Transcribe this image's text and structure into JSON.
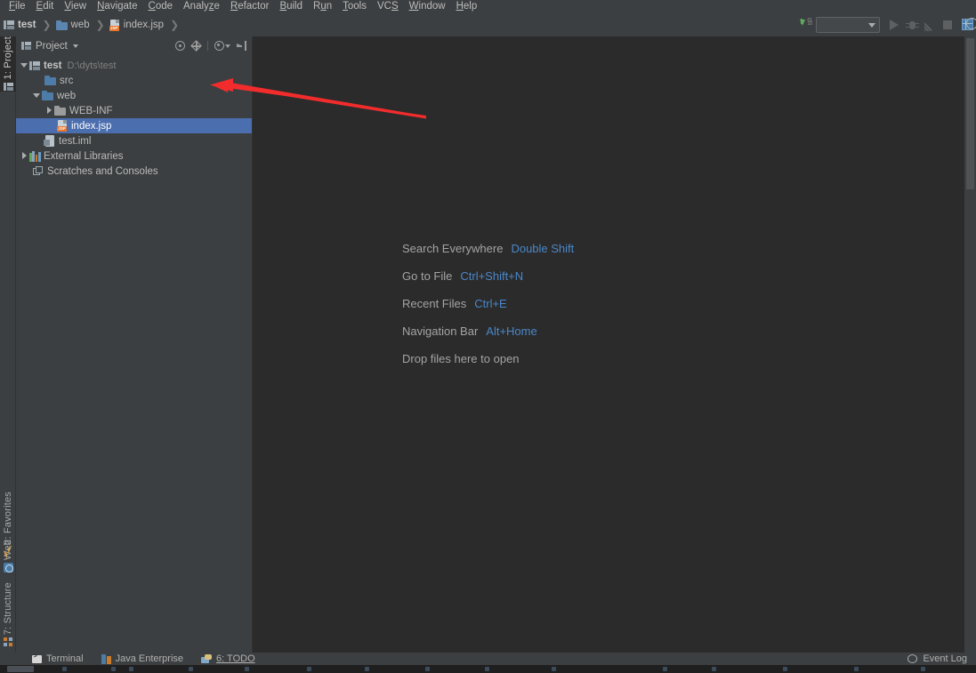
{
  "menubar": {
    "items": [
      {
        "label": "File",
        "mnemonic": "F"
      },
      {
        "label": "Edit",
        "mnemonic": "E"
      },
      {
        "label": "View",
        "mnemonic": "V"
      },
      {
        "label": "Navigate",
        "mnemonic": "N"
      },
      {
        "label": "Code",
        "mnemonic": "C"
      },
      {
        "label": "Analyze",
        "mnemonic": "z"
      },
      {
        "label": "Refactor",
        "mnemonic": "R"
      },
      {
        "label": "Build",
        "mnemonic": "B"
      },
      {
        "label": "Run",
        "mnemonic": "u"
      },
      {
        "label": "Tools",
        "mnemonic": "T"
      },
      {
        "label": "VCS",
        "mnemonic": "S"
      },
      {
        "label": "Window",
        "mnemonic": "W"
      },
      {
        "label": "Help",
        "mnemonic": "H"
      }
    ]
  },
  "breadcrumb": {
    "items": [
      {
        "label": "test",
        "icon": "project-module-icon"
      },
      {
        "label": "web",
        "icon": "folder-icon"
      },
      {
        "label": "index.jsp",
        "icon": "jsp-file-icon"
      }
    ],
    "separator": "❯",
    "jsp_badge": "JSP"
  },
  "toolbar": {
    "run_config_value": "",
    "run_config_placeholder": "",
    "buttons": [
      {
        "name": "run-button",
        "label": "Run",
        "enabled": false
      },
      {
        "name": "debug-button",
        "label": "Debug",
        "enabled": false
      },
      {
        "name": "coverage-button",
        "label": "Run with Coverage",
        "enabled": false
      },
      {
        "name": "stop-button",
        "label": "Stop",
        "enabled": false
      }
    ],
    "updown_label": "01\n10",
    "search_label": "Search"
  },
  "tool_stripe": {
    "left": [
      {
        "label": "1: Project",
        "icon": "project-icon",
        "active": true
      },
      {
        "label": "2: Favorites",
        "icon": "star-icon",
        "active": false
      },
      {
        "label": "Web",
        "icon": "web-icon",
        "active": false
      },
      {
        "label": "7: Structure",
        "icon": "structure-icon",
        "active": false
      }
    ]
  },
  "project_panel": {
    "title": "Project",
    "tools": [
      {
        "name": "scroll-from-source-icon",
        "label": "Select Opened File"
      },
      {
        "name": "collapse-all-icon",
        "label": "Collapse All"
      },
      {
        "name": "gear-icon",
        "label": "Settings"
      },
      {
        "name": "hide-panel-icon",
        "label": "Hide"
      }
    ],
    "tree": [
      {
        "label": "test",
        "path": "D:\\dyts\\test",
        "icon": "project-module-icon",
        "twisty": "open",
        "indent": 0,
        "bold": true,
        "selected": false
      },
      {
        "label": "src",
        "path": "",
        "icon": "source-folder-icon",
        "twisty": "none",
        "indent": 1,
        "bold": false,
        "selected": false
      },
      {
        "label": "web",
        "path": "",
        "icon": "source-folder-icon",
        "twisty": "open",
        "indent": 1,
        "bold": false,
        "selected": false
      },
      {
        "label": "WEB-INF",
        "path": "",
        "icon": "folder-gray-icon",
        "twisty": "closed",
        "indent": 2,
        "bold": false,
        "selected": false
      },
      {
        "label": "index.jsp",
        "path": "",
        "icon": "jsp-file-icon",
        "twisty": "none",
        "indent": 2,
        "bold": false,
        "selected": true
      },
      {
        "label": "test.iml",
        "path": "",
        "icon": "iml-file-icon",
        "twisty": "none",
        "indent": 1,
        "bold": false,
        "selected": false
      },
      {
        "label": "External Libraries",
        "path": "",
        "icon": "library-icon",
        "twisty": "closed",
        "indent": 0,
        "bold": false,
        "selected": false
      },
      {
        "label": "Scratches and Consoles",
        "path": "",
        "icon": "scratches-icon",
        "twisty": "none",
        "indent": 0,
        "bold": false,
        "selected": false
      }
    ]
  },
  "editor": {
    "hints": [
      {
        "name": "Search Everywhere",
        "key": "Double Shift"
      },
      {
        "name": "Go to File",
        "key": "Ctrl+Shift+N"
      },
      {
        "name": "Recent Files",
        "key": "Ctrl+E"
      },
      {
        "name": "Navigation Bar",
        "key": "Alt+Home"
      },
      {
        "name": "Drop files here to open",
        "key": ""
      }
    ]
  },
  "statusbar": {
    "tabs": [
      {
        "label": "Terminal",
        "icon": "terminal-icon",
        "mnemonic": ""
      },
      {
        "label": "Java Enterprise",
        "icon": "java-enterprise-icon",
        "mnemonic": ""
      },
      {
        "label": "6: TODO",
        "icon": "todo-icon",
        "mnemonic": "6"
      }
    ],
    "event_log": "Event Log"
  },
  "colors": {
    "panel_bg": "#3c3f41",
    "editor_bg": "#2b2b2b",
    "selection": "#4b6eaf",
    "hint_key": "#4a87c9",
    "text": "#bbbbbb",
    "annotation_arrow": "#f22c2c"
  },
  "annotation": {
    "type": "arrow",
    "direction": "left",
    "target": "index.jsp tree node"
  }
}
